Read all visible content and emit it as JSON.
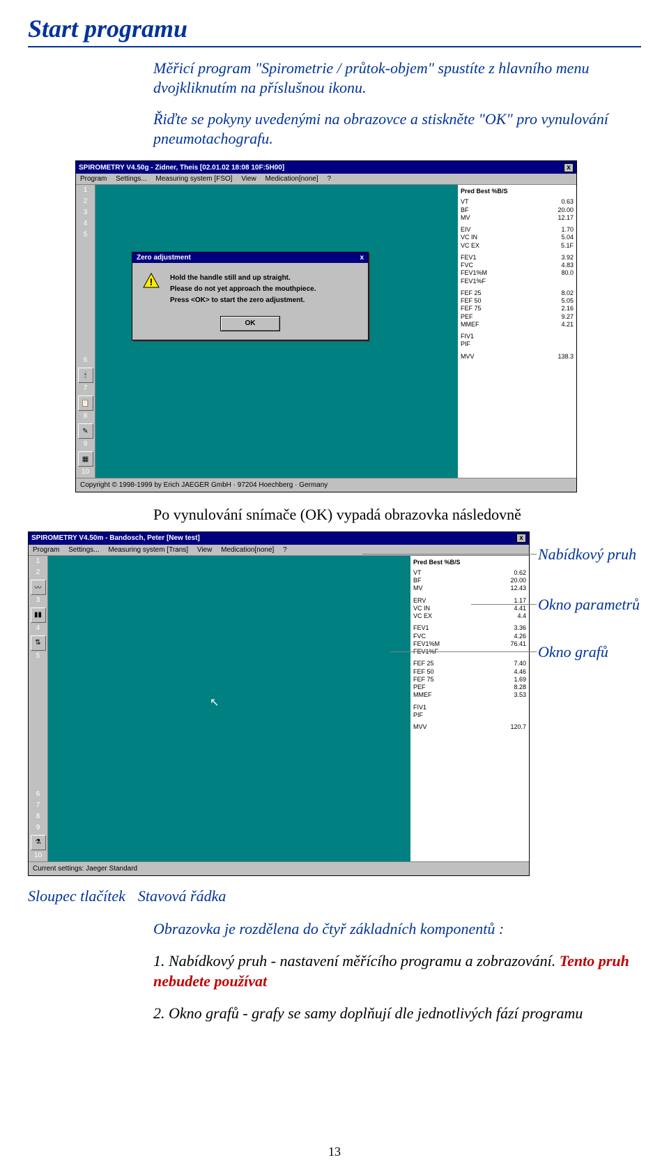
{
  "heading": "Start programu",
  "intro": {
    "p1": "Měřicí program \"Spirometrie / průtok-objem\" spustíte z hlavního menu dvojkliknutím na příslušnou ikonu.",
    "p2": "Řiďte se pokyny uvedenými na obrazovce a stiskněte \"OK\" pro vynulování pneumotachografu."
  },
  "shot1": {
    "title": "SPIROMETRY V4.50g - Zidner, Theis [02.01.02 18:08 10F:5H00]",
    "menu": [
      "Program",
      "Settings...",
      "Measuring system [FSO]",
      "View",
      "Medication[none]",
      "?"
    ],
    "paramHeader": "Pred   Best %B/S",
    "params": [
      {
        "k": "VT",
        "v": "0.63"
      },
      {
        "k": "BF",
        "v": "20.00"
      },
      {
        "k": "MV",
        "v": "12.17"
      },
      {
        "gap": true
      },
      {
        "k": "EIV",
        "v": "1.70"
      },
      {
        "k": "VC IN",
        "v": "5.04"
      },
      {
        "k": "VC EX",
        "v": "5.1F"
      },
      {
        "gap": true
      },
      {
        "k": "FEV1",
        "v": "3.92"
      },
      {
        "k": "FVC",
        "v": "4.83"
      },
      {
        "k": "FEV1%M",
        "v": "80.0"
      },
      {
        "k": "FEV1%F",
        "v": ""
      },
      {
        "gap": true
      },
      {
        "k": "FEF 25",
        "v": "8.02"
      },
      {
        "k": "FEF 50",
        "v": "5.05"
      },
      {
        "k": "FEF 75",
        "v": "2.16"
      },
      {
        "k": "PEF",
        "v": "9.27"
      },
      {
        "k": "MMEF",
        "v": "4.21"
      },
      {
        "gap": true
      },
      {
        "k": "FIV1",
        "v": ""
      },
      {
        "k": "PIF",
        "v": ""
      },
      {
        "gap": true
      },
      {
        "k": "MVV",
        "v": "138.3"
      }
    ],
    "dialogTitle": "Zero adjustment",
    "dialogL1": "Hold the handle still and up straight.",
    "dialogL2": "Please do not yet approach the mouthpiece.",
    "dialogL3": "Press <OK> to start the zero adjustment.",
    "dialogOK": "OK",
    "status": "Copyright © 1998-1999 by Erich JAEGER GmbH · 97204 Hoechberg · Germany",
    "toolbarNums": [
      "1",
      "2",
      "3",
      "4",
      "5",
      "6",
      "7",
      "8",
      "9",
      "10"
    ],
    "toolbarIcons": [
      "candle-icon",
      "clipboard-icon",
      "pen-icon",
      "grid-icon"
    ]
  },
  "caption": "Po vynulování snímače (OK) vypadá obrazovka následovně",
  "shot2": {
    "title": "SPIROMETRY V4.50m - Bandosch, Peter [New test]",
    "menu": [
      "Program",
      "Settings...",
      "Measuring system [Trans]",
      "View",
      "Medication[none]",
      "?"
    ],
    "paramHeader": "Pred   Best %B/S",
    "params": [
      {
        "k": "VT",
        "v": "0.62"
      },
      {
        "k": "BF",
        "v": "20.00"
      },
      {
        "k": "MV",
        "v": "12.43"
      },
      {
        "gap": true
      },
      {
        "k": "ERV",
        "v": "1.17"
      },
      {
        "k": "VC IN",
        "v": "4.41"
      },
      {
        "k": "VC EX",
        "v": "4.4"
      },
      {
        "gap": true
      },
      {
        "k": "FEV1",
        "v": "3.36"
      },
      {
        "k": "FVC",
        "v": "4.26"
      },
      {
        "k": "FEV1%M",
        "v": "76.41"
      },
      {
        "k": "FEV1%F",
        "v": ""
      },
      {
        "gap": true
      },
      {
        "k": "FEF 25",
        "v": "7.40"
      },
      {
        "k": "FEF 50",
        "v": "4.46"
      },
      {
        "k": "FEF 75",
        "v": "1.69"
      },
      {
        "k": "PEF",
        "v": "8.28"
      },
      {
        "k": "MMEF",
        "v": "3.53"
      },
      {
        "gap": true
      },
      {
        "k": "FIV1",
        "v": ""
      },
      {
        "k": "PIF",
        "v": ""
      },
      {
        "gap": true
      },
      {
        "k": "MVV",
        "v": "120.7"
      }
    ],
    "status": "Current settings: Jaeger Standard",
    "toolbarNums": [
      "1",
      "2",
      "3",
      "4",
      "5",
      "6",
      "7",
      "8",
      "9",
      "10"
    ],
    "toolbarIcons": [
      "wave-icon",
      "bars-icon",
      "beaker-icon",
      "flow-icon"
    ]
  },
  "annotations": {
    "menubar": "Nabídkový pruh",
    "params": "Okno parametrů",
    "graphs": "Okno grafů",
    "toolbar": "Sloupec tlačítek",
    "status": "Stavová řádka"
  },
  "body": {
    "p1": "Obrazovka je rozdělena do čtyř základních komponentů :",
    "p2a": "1. Nabídkový pruh - nastavení měřícího programu a zobrazování. ",
    "p2b": "Tento pruh nebudete používat",
    "p3": "2. Okno grafů - grafy se samy doplňují dle jednotlivých fází programu"
  },
  "pageNum": "13"
}
